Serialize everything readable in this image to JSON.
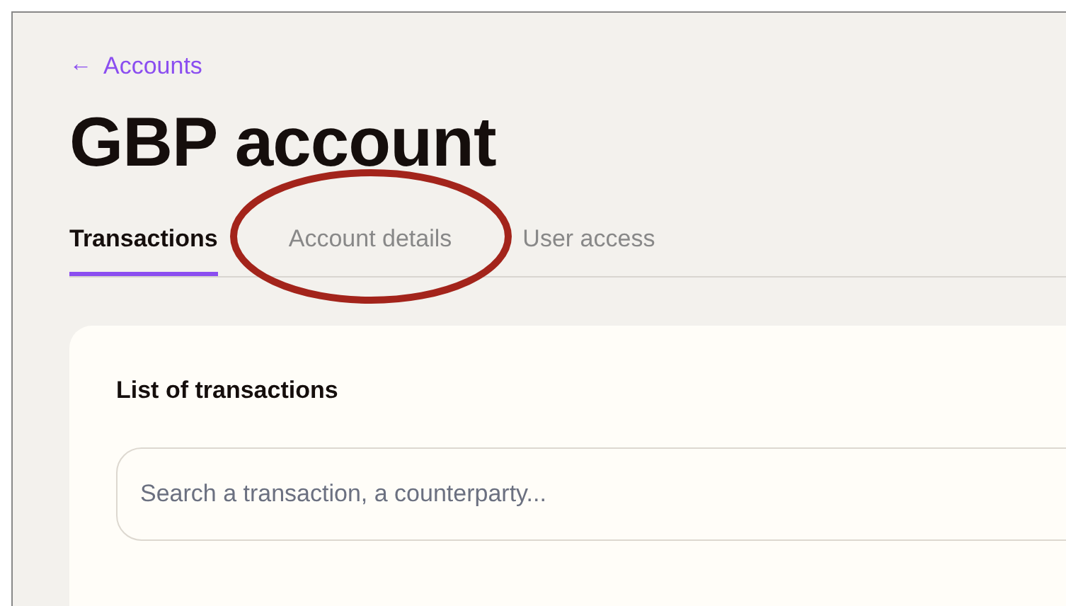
{
  "back_link": {
    "icon": "←",
    "label": "Accounts"
  },
  "title": "GBP account",
  "tabs": [
    {
      "label": "Transactions",
      "selected": true,
      "circled": false
    },
    {
      "label": "Account details",
      "selected": false,
      "circled": true
    },
    {
      "label": "User access",
      "selected": false,
      "circled": false
    }
  ],
  "card": {
    "heading": "List of transactions",
    "search": {
      "placeholder": "Search a transaction, a counterparty..."
    }
  }
}
